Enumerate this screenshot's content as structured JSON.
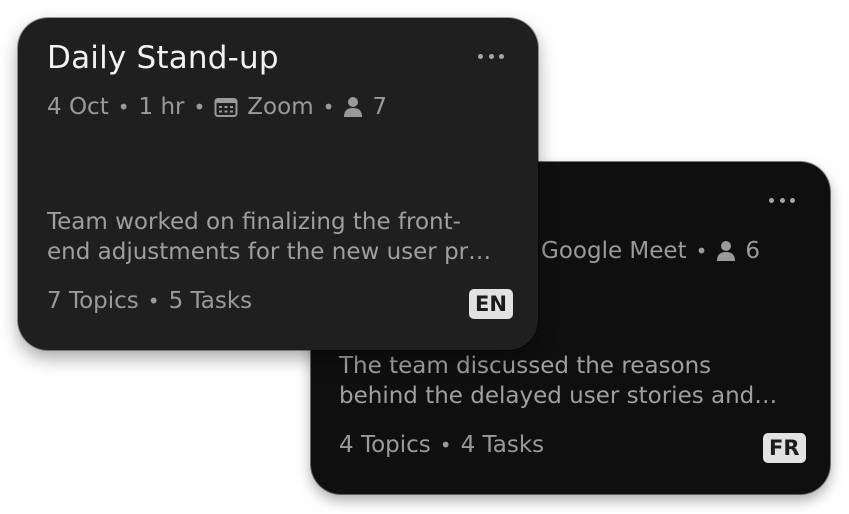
{
  "cards": [
    {
      "title": "",
      "date": "",
      "duration": "",
      "platform": "Google Meet",
      "attendees": "6",
      "summary_lines": [
        "The team discussed the reasons",
        "behind the delayed user stories and…"
      ],
      "topics": "4 Topics",
      "tasks": "4 Tasks",
      "language": "FR"
    },
    {
      "title": "Daily Stand-up",
      "date": "4 Oct",
      "duration": "1 hr",
      "platform": "Zoom",
      "attendees": "7",
      "summary_lines": [
        "Team worked on finalizing the front-",
        "end adjustments for the new user pr…"
      ],
      "topics": "7 Topics",
      "tasks": "5 Tasks",
      "language": "EN"
    }
  ],
  "separator": "•",
  "icons": {
    "more": "more-horizontal-icon",
    "calendar": "calendar-icon",
    "person": "person-icon"
  },
  "colors": {
    "front_card_bg": "#1f1f1f",
    "back_card_bg": "#0f0f0f",
    "badge_bg": "#e2e2e2"
  }
}
